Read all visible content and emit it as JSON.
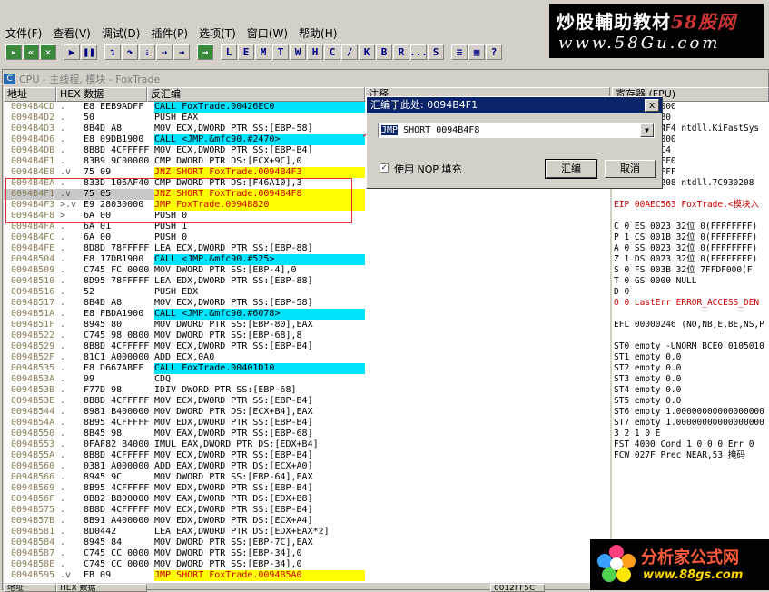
{
  "watermark_top": {
    "line1": "炒股輔助教材",
    "line1_accent": "58股网",
    "line2": "www.58Gu.com"
  },
  "menu": [
    "文件(F)",
    "查看(V)",
    "调试(D)",
    "插件(P)",
    "选项(T)",
    "窗口(W)",
    "帮助(H)"
  ],
  "toolbar_letters": [
    "L",
    "E",
    "M",
    "T",
    "W",
    "H",
    "C",
    "/",
    "K",
    "B",
    "R",
    "...",
    "S"
  ],
  "window_title": "CPU - 主线程, 模块 - FoxTrade",
  "columns": {
    "addr": "地址",
    "hex": "HEX 数据",
    "dis": "反汇编",
    "comment": "注释",
    "regs": "寄存器 (FPU)"
  },
  "rows": [
    {
      "a": "0094B4CD",
      "m": ".",
      "h": "E8 EEB9ADFF",
      "d": "CALL FoxTrade.00426EC0",
      "s": "c"
    },
    {
      "a": "0094B4D2",
      "m": ".",
      "h": "50",
      "d": "PUSH EAX",
      "s": ""
    },
    {
      "a": "0094B4D3",
      "m": ".",
      "h": "8B4D A8",
      "d": "MOV ECX,DWORD PTR SS:[EBP-58]",
      "s": "cb"
    },
    {
      "a": "0094B4D6",
      "m": ".",
      "h": "E8 09DB1900",
      "d": "CALL <JMP.&mfc90.#2470>",
      "s": "c"
    },
    {
      "a": "0094B4DB",
      "m": ".",
      "h": "8B8D 4CFFFFFF",
      "d": "MOV ECX,DWORD PTR SS:[EBP-B4]",
      "s": "cb"
    },
    {
      "a": "0094B4E1",
      "m": ".",
      "h": "83B9 9C000000",
      "d": "CMP DWORD PTR DS:[ECX+9C],0",
      "s": ""
    },
    {
      "a": "0094B4E8",
      "m": ".v",
      "h": "75 09",
      "d": "JNZ SHORT FoxTrade.0094B4F3",
      "s": "y"
    },
    {
      "a": "0094B4EA",
      "m": ".",
      "h": "833D 106AF400",
      "d": "CMP DWORD PTR DS:[F46A10],3",
      "s": ""
    },
    {
      "a": "0094B4F1",
      "m": ".v",
      "h": "75 05",
      "d": "JNZ SHORT FoxTrade.0094B4F8",
      "s": "y",
      "sel": true
    },
    {
      "a": "0094B4F3",
      "m": ">.v",
      "h": "E9 28030000",
      "d": "JMP FoxTrade.0094B820",
      "s": "y"
    },
    {
      "a": "0094B4F8",
      "m": ">",
      "h": "6A 00",
      "d": "PUSH 0",
      "s": "cb"
    },
    {
      "a": "0094B4FA",
      "m": ".",
      "h": "6A 01",
      "d": "PUSH 1",
      "s": ""
    },
    {
      "a": "0094B4FC",
      "m": ".",
      "h": "6A 00",
      "d": "PUSH 0",
      "s": ""
    },
    {
      "a": "0094B4FE",
      "m": ".",
      "h": "8D8D 78FFFFFF",
      "d": "LEA ECX,DWORD PTR SS:[EBP-88]",
      "s": "cb"
    },
    {
      "a": "0094B504",
      "m": ".",
      "h": "E8 17DB1900",
      "d": "CALL <JMP.&mfc90.#525>",
      "s": "c"
    },
    {
      "a": "0094B509",
      "m": ".",
      "h": "C745 FC 000000",
      "d": "MOV DWORD PTR SS:[EBP-4],0",
      "s": "cb"
    },
    {
      "a": "0094B510",
      "m": ".",
      "h": "8D95 78FFFFFF",
      "d": "LEA EDX,DWORD PTR SS:[EBP-88]",
      "s": "cb"
    },
    {
      "a": "0094B516",
      "m": ".",
      "h": "52",
      "d": "PUSH EDX",
      "s": ""
    },
    {
      "a": "0094B517",
      "m": ".",
      "h": "8B4D A8",
      "d": "MOV ECX,DWORD PTR SS:[EBP-58]",
      "s": "cb"
    },
    {
      "a": "0094B51A",
      "m": ".",
      "h": "E8 FBDA1900",
      "d": "CALL <JMP.&mfc90.#6078>",
      "s": "c"
    },
    {
      "a": "0094B51F",
      "m": ".",
      "h": "8945 80",
      "d": "MOV DWORD PTR SS:[EBP-80],EAX",
      "s": "cb"
    },
    {
      "a": "0094B522",
      "m": ".",
      "h": "C745 98 080000",
      "d": "MOV DWORD PTR SS:[EBP-68],8",
      "s": "cb"
    },
    {
      "a": "0094B529",
      "m": ".",
      "h": "8B8D 4CFFFFFF",
      "d": "MOV ECX,DWORD PTR SS:[EBP-B4]",
      "s": "cb"
    },
    {
      "a": "0094B52F",
      "m": ".",
      "h": "81C1 A0000000",
      "d": "ADD ECX,0A0",
      "s": ""
    },
    {
      "a": "0094B535",
      "m": ".",
      "h": "E8 D667ABFF",
      "d": "CALL FoxTrade.00401D10",
      "s": "c"
    },
    {
      "a": "0094B53A",
      "m": ".",
      "h": "99",
      "d": "CDQ",
      "s": ""
    },
    {
      "a": "0094B53B",
      "m": ".",
      "h": "F77D 98",
      "d": "IDIV DWORD PTR SS:[EBP-68]",
      "s": "cb"
    },
    {
      "a": "0094B53E",
      "m": ".",
      "h": "8B8D 4CFFFFFF",
      "d": "MOV ECX,DWORD PTR SS:[EBP-B4]",
      "s": "cb"
    },
    {
      "a": "0094B544",
      "m": ".",
      "h": "8981 B4000000",
      "d": "MOV DWORD PTR DS:[ECX+B4],EAX",
      "s": ""
    },
    {
      "a": "0094B54A",
      "m": ".",
      "h": "8B95 4CFFFFFF",
      "d": "MOV EDX,DWORD PTR SS:[EBP-B4]",
      "s": "cb"
    },
    {
      "a": "0094B550",
      "m": ".",
      "h": "8B45 98",
      "d": "MOV EAX,DWORD PTR SS:[EBP-68]",
      "s": "cb"
    },
    {
      "a": "0094B553",
      "m": ".",
      "h": "0FAF82 B40000",
      "d": "IMUL EAX,DWORD PTR DS:[EDX+B4]",
      "s": ""
    },
    {
      "a": "0094B55A",
      "m": ".",
      "h": "8B8D 4CFFFFFF",
      "d": "MOV ECX,DWORD PTR SS:[EBP-B4]",
      "s": "cb"
    },
    {
      "a": "0094B560",
      "m": ".",
      "h": "0381 A0000000",
      "d": "ADD EAX,DWORD PTR DS:[ECX+A0]",
      "s": ""
    },
    {
      "a": "0094B566",
      "m": ".",
      "h": "8945 9C",
      "d": "MOV DWORD PTR SS:[EBP-64],EAX",
      "s": "cb"
    },
    {
      "a": "0094B569",
      "m": ".",
      "h": "8B95 4CFFFFFF",
      "d": "MOV EDX,DWORD PTR SS:[EBP-B4]",
      "s": "cb"
    },
    {
      "a": "0094B56F",
      "m": ".",
      "h": "8B82 B8000000",
      "d": "MOV EAX,DWORD PTR DS:[EDX+B8]",
      "s": ""
    },
    {
      "a": "0094B575",
      "m": ".",
      "h": "8B8D 4CFFFFFF",
      "d": "MOV ECX,DWORD PTR SS:[EBP-B4]",
      "s": "cb"
    },
    {
      "a": "0094B57B",
      "m": ".",
      "h": "8B91 A4000000",
      "d": "MOV EDX,DWORD PTR DS:[ECX+A4]",
      "s": ""
    },
    {
      "a": "0094B581",
      "m": ".",
      "h": "8D0442",
      "d": "LEA EAX,DWORD PTR DS:[EDX+EAX*2]",
      "s": ""
    },
    {
      "a": "0094B584",
      "m": ".",
      "h": "8945 84",
      "d": "MOV DWORD PTR SS:[EBP-7C],EAX",
      "s": "cb"
    },
    {
      "a": "0094B587",
      "m": ".",
      "h": "C745 CC 000000",
      "d": "MOV DWORD PTR SS:[EBP-34],0",
      "s": "cb"
    },
    {
      "a": "0094B58E",
      "m": ".",
      "h": "C745 CC 000000",
      "d": "MOV DWORD PTR SS:[EBP-34],0",
      "s": "cb"
    },
    {
      "a": "0094B595",
      "m": ".v",
      "h": "EB 09",
      "d": "JMP SHORT FoxTrade.0094B5A0",
      "s": "y"
    }
  ],
  "registers": [
    {
      "t": "EAX 00000000",
      "r": false
    },
    {
      "t": "ECX 0012FB0",
      "r": false
    },
    {
      "t": "EDX 7C92E4F4 ntdll.KiFastSys",
      "r": false
    },
    {
      "t": "EBX 00000000",
      "r": false
    },
    {
      "t": "ESP 0012FC4",
      "r": false
    },
    {
      "t": "EBP 0012FFF0",
      "r": false
    },
    {
      "t": "ESI FFFFFFFF",
      "r": false
    },
    {
      "t": "EDI 7C930208 ntdll.7C930208",
      "r": false
    },
    {
      "t": "",
      "r": false
    },
    {
      "t": "EIP 00AEC563 FoxTrade.<模块入",
      "r": true
    },
    {
      "t": "",
      "r": false
    },
    {
      "t": "C 0  ES 0023 32位 0(FFFFFFFF)",
      "r": false
    },
    {
      "t": "P 1  CS 001B 32位 0(FFFFFFFF)",
      "r": false
    },
    {
      "t": "A 0  SS 0023 32位 0(FFFFFFFF)",
      "r": false
    },
    {
      "t": "Z 1  DS 0023 32位 0(FFFFFFFF)",
      "r": false
    },
    {
      "t": "S 0  FS 003B 32位 7FFDF000(F",
      "r": false
    },
    {
      "t": "T 0  GS 0000 NULL",
      "r": false
    },
    {
      "t": "D 0",
      "r": false
    },
    {
      "t": "O 0  LastErr ERROR_ACCESS_DEN",
      "r": true
    },
    {
      "t": "",
      "r": false
    },
    {
      "t": "EFL 00000246 (NO,NB,E,BE,NS,P",
      "r": false
    },
    {
      "t": "",
      "r": false
    },
    {
      "t": "ST0 empty -UNORM BCE0 0105010",
      "r": false
    },
    {
      "t": "ST1 empty 0.0",
      "r": false
    },
    {
      "t": "ST2 empty 0.0",
      "r": false
    },
    {
      "t": "ST3 empty 0.0",
      "r": false
    },
    {
      "t": "ST4 empty 0.0",
      "r": false
    },
    {
      "t": "ST5 empty 0.0",
      "r": false
    },
    {
      "t": "ST6 empty 1.00000000000000000",
      "r": false
    },
    {
      "t": "ST7 empty 1.00000000000000000",
      "r": false
    },
    {
      "t": "                3 2 1 0     E",
      "r": false
    },
    {
      "t": "FST 4000  Cond 1 0 0 0  Err 0",
      "r": false
    },
    {
      "t": "FCW 027F  Prec NEAR,53  掩码",
      "r": false
    }
  ],
  "dialog": {
    "title": "汇编于此处: 0094B4F1",
    "instruction": "JMP SHORT 0094B4F8",
    "instr_sel": "JMP",
    "checkbox_label": "使用 NOP 填充",
    "ok": "汇编",
    "cancel": "取消",
    "close": "x"
  },
  "bottom": {
    "addr": "地址",
    "hex": "HEX 数据",
    "val": "0012FF5C"
  },
  "watermark_bottom": {
    "line1": "分析家公式网",
    "line2": "www.88gs.com"
  }
}
